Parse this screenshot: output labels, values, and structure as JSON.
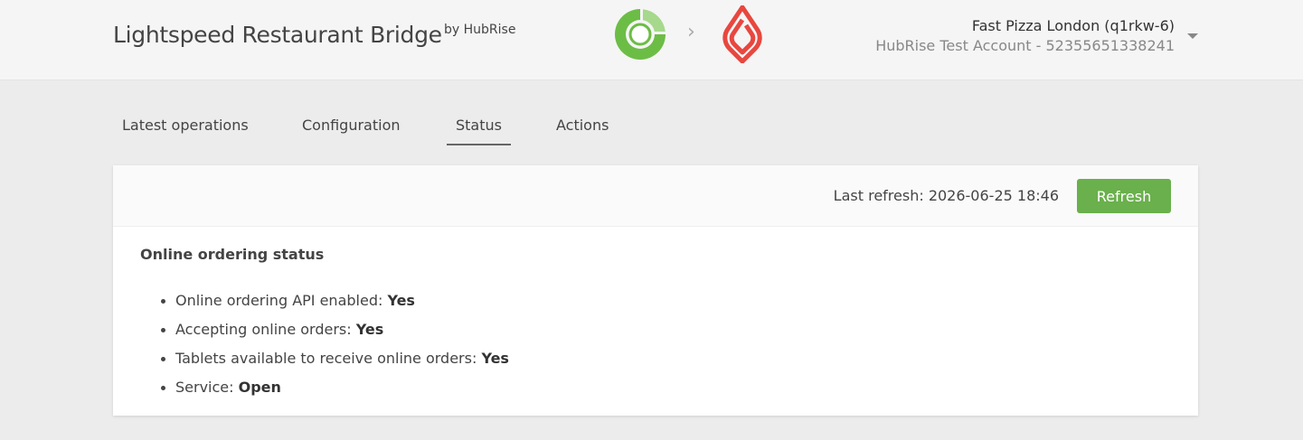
{
  "header": {
    "title": "Lightspeed Restaurant Bridge",
    "by": "by HubRise",
    "account_name": "Fast Pizza London (q1rkw-6)",
    "account_sub": "HubRise Test Account - 52355651338241",
    "source_logo": "hubrise-logo",
    "target_logo": "lightspeed-logo",
    "arrow": "›"
  },
  "tabs": [
    {
      "label": "Latest operations",
      "active": false
    },
    {
      "label": "Configuration",
      "active": false
    },
    {
      "label": "Status",
      "active": true
    },
    {
      "label": "Actions",
      "active": false
    }
  ],
  "toolbar": {
    "last_refresh": "Last refresh: 2026-06-25 18:46",
    "refresh_label": "Refresh"
  },
  "status": {
    "title": "Online ordering status",
    "items": [
      {
        "label": "Online ordering API enabled: ",
        "value": "Yes"
      },
      {
        "label": "Accepting online orders: ",
        "value": "Yes"
      },
      {
        "label": "Tablets available to receive online orders: ",
        "value": "Yes"
      },
      {
        "label": "Service: ",
        "value": "Open"
      }
    ]
  },
  "colors": {
    "accent_green": "#6ab04c",
    "hubrise_green": "#6cbd45",
    "lightspeed_red": "#e8473f"
  }
}
